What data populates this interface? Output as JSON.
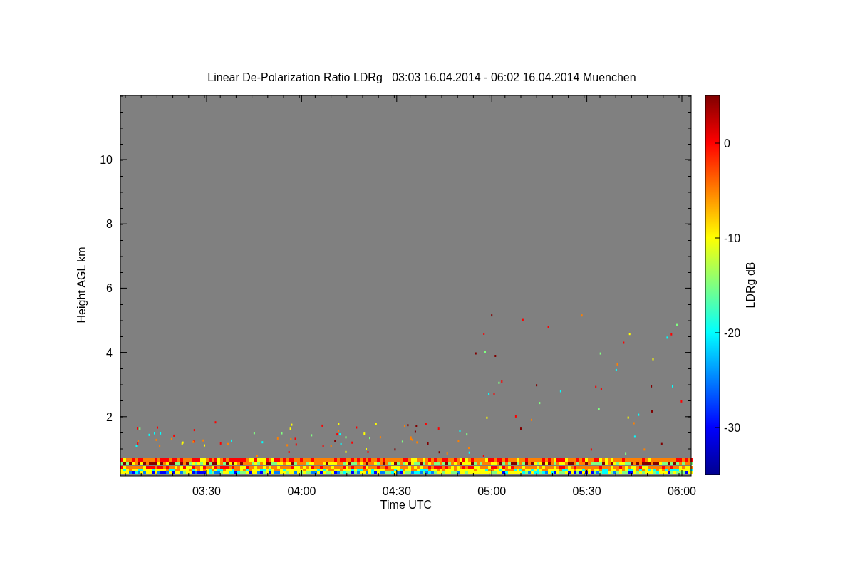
{
  "title": "Linear De-Polarization Ratio LDRg   03:03 16.04.2014 - 06:02 16.04.2014 Muenchen",
  "plot": {
    "xlabel": "Time UTC",
    "ylabel": "Height AGL km",
    "xticks": [
      "03:30",
      "04:00",
      "04:30",
      "05:00",
      "05:30",
      "06:00"
    ],
    "yticks": [
      "10",
      "8",
      "6",
      "4",
      "2"
    ]
  },
  "colorbar": {
    "label": "LDRg dB",
    "ticks": [
      "0",
      "-10",
      "-20",
      "-30"
    ]
  }
}
